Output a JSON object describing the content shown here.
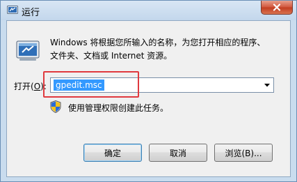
{
  "window": {
    "title": "运行"
  },
  "icons": {
    "title_icon": "run-icon",
    "close_icon": "close-icon",
    "big_icon": "run-program-icon",
    "dropdown_icon": "chevron-down-icon",
    "shield_icon": "uac-shield-icon"
  },
  "content": {
    "description_line1": "Windows 将根据您所输入的名称，为您打开相应的程序、",
    "description_line2": "文件夹、文档或 Internet 资源。",
    "open_label_prefix": "打开(",
    "open_label_key": "O",
    "open_label_suffix": "):",
    "input_value": "gpedit.msc",
    "admin_note": "使用管理权限创建此任务。"
  },
  "buttons": {
    "ok": "确定",
    "cancel": "取消",
    "browse": "浏览(B)..."
  },
  "colors": {
    "highlight_border": "#e0393e",
    "selection_bg": "#3399ff",
    "close_button": "#c23d21"
  }
}
